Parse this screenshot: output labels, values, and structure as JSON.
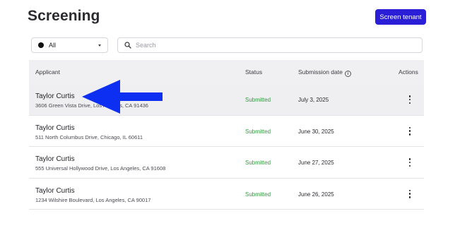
{
  "header": {
    "title": "Screening",
    "primary_button": "Screen tenant"
  },
  "filters": {
    "status_selected": "All",
    "search_placeholder": "Search"
  },
  "table": {
    "columns": {
      "applicant": "Applicant",
      "status": "Status",
      "submission_date": "Submission date",
      "actions": "Actions"
    },
    "rows": [
      {
        "name": "Taylor Curtis",
        "address": "3606 Green Vista Drive, Los Angeles, CA 91436",
        "status": "Submitted",
        "date": "July 3, 2025"
      },
      {
        "name": "Taylor Curtis",
        "address": "511 North Columbus Drive, Chicago, IL 60611",
        "status": "Submitted",
        "date": "June 30, 2025"
      },
      {
        "name": "Taylor Curtis",
        "address": "555 Universal Hollywood Drive, Los Angeles, CA 91608",
        "status": "Submitted",
        "date": "June 27, 2025"
      },
      {
        "name": "Taylor Curtis",
        "address": "1234 Wilshire Boulevard, Los Angeles, CA 90017",
        "status": "Submitted",
        "date": "June 26, 2025"
      }
    ]
  },
  "colors": {
    "primary": "#2a1fd6",
    "status_submitted": "#2f9a3c",
    "annotation_arrow": "#0c2ff2",
    "header_bg": "#f0f0f3"
  },
  "icons": {
    "search": "search-icon",
    "info": "info-icon",
    "kebab": "kebab-menu-icon",
    "caret": "chevron-down-icon"
  }
}
